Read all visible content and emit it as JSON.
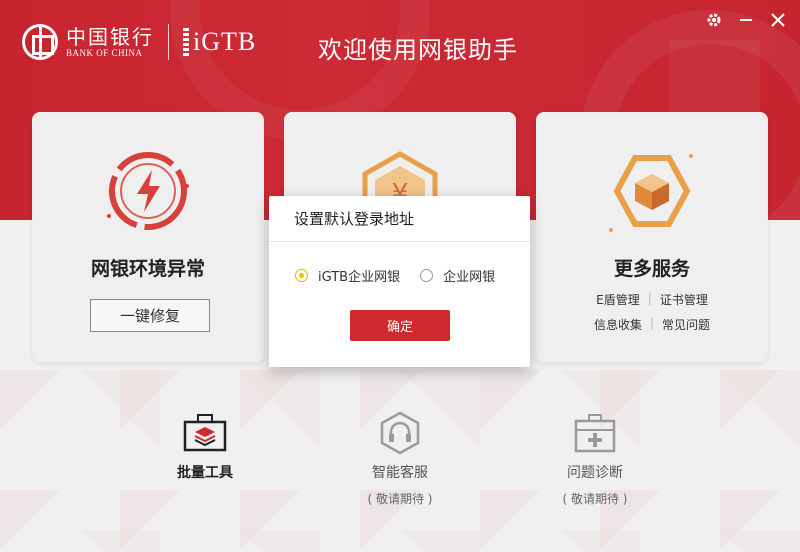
{
  "header": {
    "bank_name_cn": "中国银行",
    "bank_name_en": "BANK OF CHINA",
    "product": "iGTB",
    "title": "欢迎使用网银助手"
  },
  "window_controls": {
    "settings_icon": "gear-icon",
    "minimize_icon": "minimize-icon",
    "close_icon": "close-icon"
  },
  "cards": {
    "env": {
      "title": "网银环境异常",
      "button": "一键修复",
      "icon": "lightning-warning-icon"
    },
    "center": {
      "icon": "yuan-hexagon-icon"
    },
    "more": {
      "title": "更多服务",
      "icon": "cube-hexagon-icon",
      "links_row1": [
        "E盾管理",
        "证书管理"
      ],
      "links_row2": [
        "信息收集",
        "常见问题"
      ]
    }
  },
  "tools": [
    {
      "name": "批量工具",
      "sub": "",
      "icon": "toolbox-icon"
    },
    {
      "name": "智能客服",
      "sub": "( 敬请期待 )",
      "icon": "headset-hexagon-icon"
    },
    {
      "name": "问题诊断",
      "sub": "( 敬请期待 )",
      "icon": "medical-kit-icon"
    }
  ],
  "dialog": {
    "title": "设置默认登录地址",
    "options": [
      "iGTB企业网银",
      "企业网银"
    ],
    "selected": "iGTB企业网银",
    "confirm": "确定"
  },
  "colors": {
    "brand_red": "#c8242f",
    "accent_orange": "#e8a04a",
    "radio_selected": "#f2c100"
  }
}
